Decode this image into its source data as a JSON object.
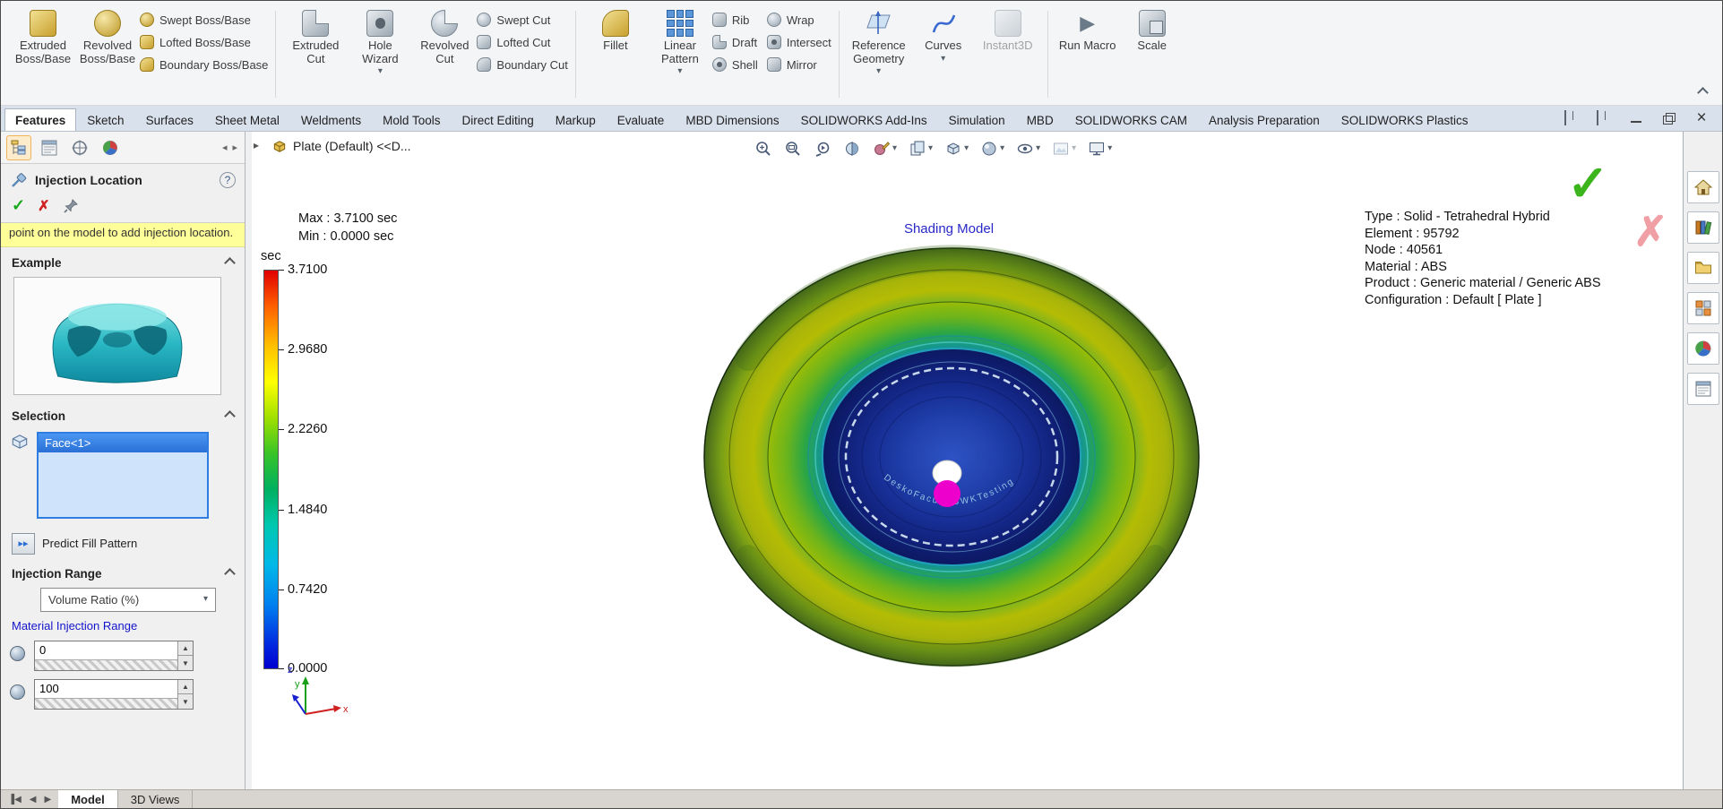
{
  "ribbon": {
    "groups": [
      {
        "large": [
          "Extruded Boss/Base",
          "Revolved Boss/Base"
        ],
        "small": [
          "Swept Boss/Base",
          "Lofted Boss/Base",
          "Boundary Boss/Base"
        ]
      },
      {
        "large": [
          "Extruded Cut",
          "Hole Wizard",
          "Revolved Cut"
        ],
        "small": [
          "Swept Cut",
          "Lofted Cut",
          "Boundary Cut"
        ]
      },
      {
        "large": [
          "Fillet",
          "Linear Pattern"
        ],
        "small": [
          "Rib",
          "Draft",
          "Shell"
        ],
        "small2": [
          "Wrap",
          "Intersect",
          "Mirror"
        ]
      },
      {
        "large": [
          "Reference Geometry",
          "Curves",
          "Instant3D"
        ]
      },
      {
        "large": [
          "Run Macro",
          "Scale"
        ]
      }
    ]
  },
  "tabs": [
    "Features",
    "Sketch",
    "Surfaces",
    "Sheet Metal",
    "Weldments",
    "Mold Tools",
    "Direct Editing",
    "Markup",
    "Evaluate",
    "MBD Dimensions",
    "SOLIDWORKS Add-Ins",
    "Simulation",
    "MBD",
    "SOLIDWORKS CAM",
    "Analysis Preparation",
    "SOLIDWORKS Plastics"
  ],
  "panel": {
    "title": "Injection Location",
    "help": "?",
    "hint": "point on the model to add injection location.",
    "example_header": "Example",
    "selection_header": "Selection",
    "selection_item": "Face<1>",
    "predict_button": "Predict Fill Pattern",
    "range_header": "Injection Range",
    "range_type": "Volume Ratio (%)",
    "material_link": "Material Injection Range",
    "range_min": "0",
    "range_max": "100"
  },
  "viewport": {
    "tree_item": "Plate (Default) <<D...",
    "plot_title": "Shading Model",
    "max_label": "Max : 3.7100 sec",
    "min_label": "Min : 0.0000 sec",
    "legend_unit": "sec",
    "legend_ticks": [
      "3.7100",
      "2.9680",
      "2.2260",
      "1.4840",
      "0.7420",
      "0.0000"
    ],
    "info": [
      "Type : Solid - Tetrahedral Hybrid",
      "Element : 95792",
      "Node : 40561",
      "Material : ABS",
      "Product : Generic material / Generic ABS",
      "Configuration : Default [ Plate ]"
    ],
    "triad": {
      "x": "x",
      "y": "y",
      "z": "z"
    },
    "engraving": "DeskoFacultySWKTesting"
  },
  "bottom_bar": {
    "tabs": [
      "Model",
      "3D Views"
    ]
  },
  "colors": {
    "selection_blue": "#2f7de1",
    "hint_yellow": "#ffff99",
    "link_blue": "#1414cc",
    "plot_title_blue": "#2828c8",
    "check_green": "#3cb41c",
    "cross_red": "#f0a0a4",
    "injection_magenta": "#ee00cc",
    "legend_top": "#e00000",
    "legend_bottom": "#0000d0"
  }
}
